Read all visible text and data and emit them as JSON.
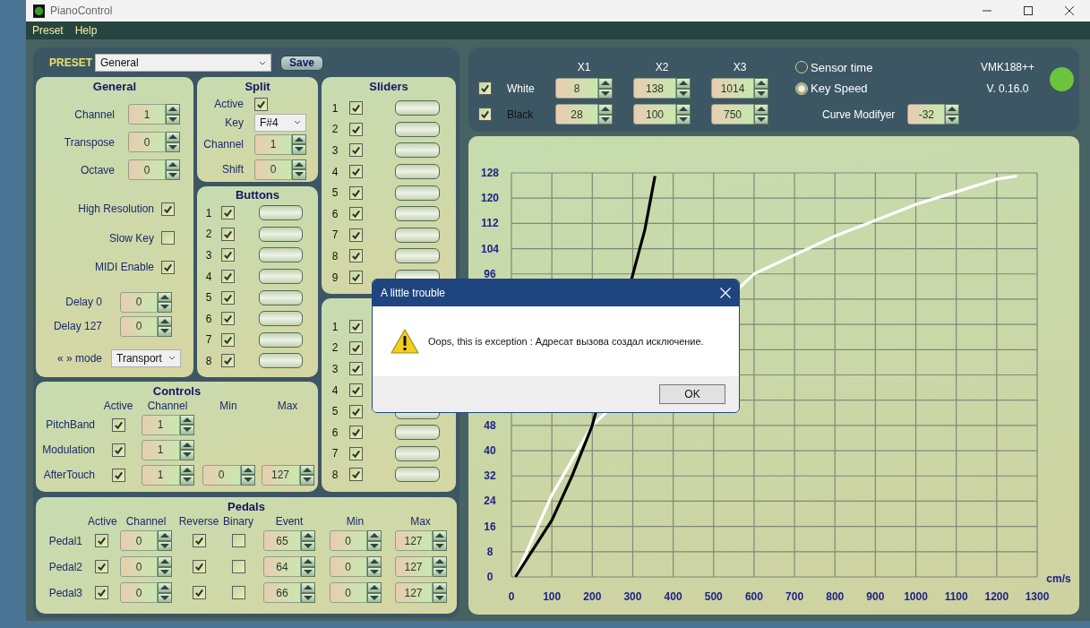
{
  "window": {
    "title": "PianoControl"
  },
  "menu": [
    "Preset",
    "Help"
  ],
  "preset": {
    "label": "PRESET",
    "value": "General",
    "save": "Save"
  },
  "general": {
    "title": "General",
    "spinners": [
      {
        "label": "Channel",
        "value": "1"
      },
      {
        "label": "Transpose",
        "value": "0"
      },
      {
        "label": "Octave",
        "value": "0"
      }
    ],
    "checks": [
      {
        "label": "High Resolution",
        "checked": true
      },
      {
        "label": "Slow Key",
        "checked": false
      },
      {
        "label": "MIDI Enable",
        "checked": true
      }
    ],
    "delays": [
      {
        "label": "Delay 0",
        "value": "0"
      },
      {
        "label": "Delay 127",
        "value": "0"
      }
    ],
    "mode": {
      "label": "« » mode",
      "value": "Transport"
    }
  },
  "split": {
    "title": "Split",
    "active_label": "Active",
    "active": true,
    "key_label": "Key",
    "key": "F#4",
    "channel_label": "Channel",
    "channel": "1",
    "shift_label": "Shift",
    "shift": "0"
  },
  "buttons": {
    "title": "Buttons",
    "rows": [
      {
        "number": "1",
        "checked": true
      },
      {
        "number": "2",
        "checked": true
      },
      {
        "number": "3",
        "checked": true
      },
      {
        "number": "4",
        "checked": true
      },
      {
        "number": "5",
        "checked": true
      },
      {
        "number": "6",
        "checked": true
      },
      {
        "number": "7",
        "checked": true
      },
      {
        "number": "8",
        "checked": true
      }
    ]
  },
  "sliders": {
    "title": "Sliders",
    "rows": [
      {
        "number": "1",
        "checked": true
      },
      {
        "number": "2",
        "checked": true
      },
      {
        "number": "3",
        "checked": true
      },
      {
        "number": "4",
        "checked": true
      },
      {
        "number": "5",
        "checked": true
      },
      {
        "number": "6",
        "checked": true
      },
      {
        "number": "7",
        "checked": true
      },
      {
        "number": "8",
        "checked": true
      },
      {
        "number": "9",
        "checked": true
      }
    ]
  },
  "sliders_2": {
    "rows": [
      {
        "number": "1",
        "checked": true
      },
      {
        "number": "2",
        "checked": true
      },
      {
        "number": "3",
        "checked": true
      },
      {
        "number": "4",
        "checked": true
      },
      {
        "number": "5",
        "checked": true
      },
      {
        "number": "6",
        "checked": true
      },
      {
        "number": "7",
        "checked": true
      },
      {
        "number": "8",
        "checked": true
      }
    ]
  },
  "controls": {
    "title": "Controls",
    "columns": [
      "Active",
      "Channel",
      "Min",
      "Max"
    ],
    "rows": [
      {
        "label": "PitchBand",
        "active": true,
        "channel": "1"
      },
      {
        "label": "Modulation",
        "active": true,
        "channel": "1"
      },
      {
        "label": "AfterTouch",
        "active": true,
        "channel": "1",
        "min": "0",
        "max": "127"
      }
    ]
  },
  "pedals": {
    "title": "Pedals",
    "columns": [
      "Active",
      "Channel",
      "Reverse",
      "Binary",
      "Event",
      "Min",
      "Max"
    ],
    "rows": [
      {
        "label": "Pedal1",
        "active": true,
        "channel": "0",
        "reverse": true,
        "binary": false,
        "event": "65",
        "min": "0",
        "max": "127"
      },
      {
        "label": "Pedal2",
        "active": true,
        "channel": "0",
        "reverse": true,
        "binary": false,
        "event": "64",
        "min": "0",
        "max": "127"
      },
      {
        "label": "Pedal3",
        "active": true,
        "channel": "0",
        "reverse": true,
        "binary": false,
        "event": "66",
        "min": "0",
        "max": "127"
      }
    ]
  },
  "velocity": {
    "columns": [
      "X1",
      "X2",
      "X3"
    ],
    "rows": [
      {
        "label": "White",
        "checked": true,
        "values": [
          "8",
          "138",
          "1014"
        ]
      },
      {
        "label": "Black",
        "checked": true,
        "values": [
          "28",
          "100",
          "750"
        ]
      }
    ],
    "modes": [
      {
        "label": "Sensor time",
        "selected": false
      },
      {
        "label": "Key Speed",
        "selected": true
      }
    ],
    "curve": {
      "label": "Curve Modifyer",
      "value": "-32"
    },
    "device": "VMK188++",
    "version": "V. 0.16.0",
    "connected": true
  },
  "chart": {
    "chart_data": {
      "type": "line",
      "xlabel": "cm/s",
      "x": [
        10,
        100,
        150,
        200,
        330,
        355,
        600,
        700,
        800,
        900,
        1000,
        1100,
        1200,
        1250
      ],
      "xlim": [
        0,
        1300
      ],
      "ylim": [
        0,
        128
      ],
      "grid": true,
      "xticks": [
        0,
        100,
        200,
        300,
        400,
        500,
        600,
        700,
        800,
        900,
        1000,
        1100,
        1200,
        1300
      ],
      "yticks": [
        0,
        8,
        16,
        24,
        32,
        40,
        48,
        96,
        104,
        112,
        120,
        128
      ],
      "series": [
        {
          "color": "#ffffff",
          "values": [
            0,
            26,
            37,
            48,
            null,
            null,
            96,
            102,
            108,
            113,
            118,
            122,
            126,
            127
          ]
        },
        {
          "color": "#000000",
          "values": [
            0,
            18,
            32,
            48,
            110,
            127,
            null,
            null,
            null,
            null,
            null,
            null,
            null,
            null
          ]
        }
      ]
    }
  },
  "dialog": {
    "title": "A little trouble",
    "message": "Oops, this is exception : Адресат вызова создал исключение.",
    "button": "OK"
  }
}
